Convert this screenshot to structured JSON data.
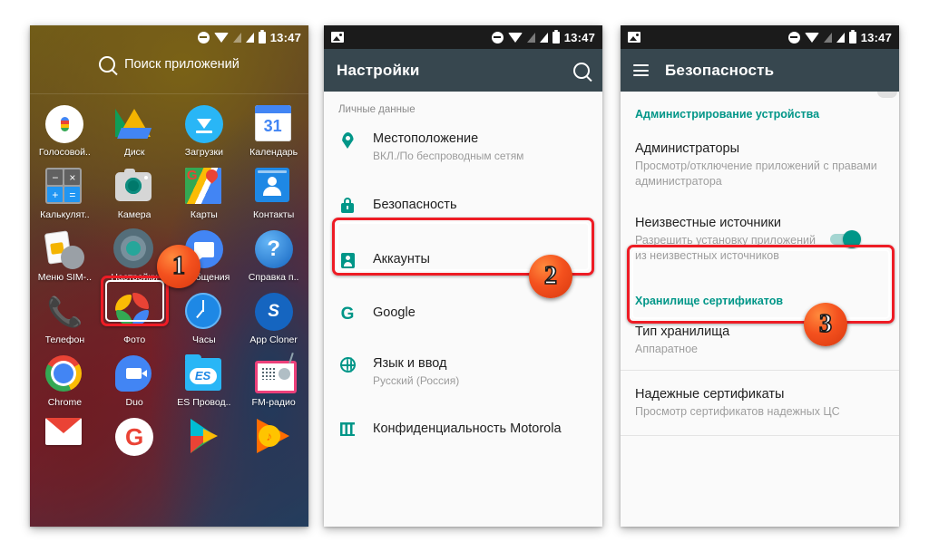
{
  "statusbar": {
    "time": "13:47",
    "icons": [
      "photo-icon",
      "dnd-icon",
      "wifi-icon",
      "signal-empty-icon",
      "signal-icon",
      "battery-icon"
    ]
  },
  "phone1": {
    "search_placeholder": "Поиск приложений",
    "apps": [
      {
        "label": "Голосовой..",
        "icon": "voice-search-icon"
      },
      {
        "label": "Диск",
        "icon": "google-drive-icon"
      },
      {
        "label": "Загрузки",
        "icon": "downloads-icon"
      },
      {
        "label": "Календарь",
        "icon": "calendar-icon",
        "value": "31"
      },
      {
        "label": "Калькулят..",
        "icon": "calculator-icon"
      },
      {
        "label": "Камера",
        "icon": "camera-icon"
      },
      {
        "label": "Карты",
        "icon": "google-maps-icon"
      },
      {
        "label": "Контакты",
        "icon": "contacts-icon"
      },
      {
        "label": "Меню SIM-..",
        "icon": "sim-menu-icon"
      },
      {
        "label": "Настройки",
        "icon": "settings-gear-icon"
      },
      {
        "label": "Сообщения",
        "icon": "messages-icon"
      },
      {
        "label": "Справка п..",
        "icon": "help-icon"
      },
      {
        "label": "Телефон",
        "icon": "phone-icon"
      },
      {
        "label": "Фото",
        "icon": "google-photos-icon"
      },
      {
        "label": "Часы",
        "icon": "clock-icon"
      },
      {
        "label": "App Cloner",
        "icon": "app-cloner-icon"
      },
      {
        "label": "Chrome",
        "icon": "chrome-icon"
      },
      {
        "label": "Duo",
        "icon": "google-duo-icon"
      },
      {
        "label": "ES Провод..",
        "icon": "es-file-explorer-icon"
      },
      {
        "label": "FM-радио",
        "icon": "fm-radio-icon"
      },
      {
        "label": "",
        "icon": "gmail-icon"
      },
      {
        "label": "",
        "icon": "google-icon"
      },
      {
        "label": "",
        "icon": "play-store-icon"
      },
      {
        "label": "",
        "icon": "play-music-icon"
      }
    ]
  },
  "phone2": {
    "title": "Настройки",
    "search_icon": "search-icon",
    "section_label": "Личные данные",
    "rows": [
      {
        "icon": "location-pin-icon",
        "title": "Местоположение",
        "subtitle": "ВКЛ./По беспроводным сетям"
      },
      {
        "icon": "lock-icon",
        "title": "Безопасность",
        "subtitle": ""
      },
      {
        "icon": "account-icon",
        "title": "Аккаунты",
        "subtitle": ""
      },
      {
        "icon": "google-g-icon",
        "title": "Google",
        "subtitle": ""
      },
      {
        "icon": "globe-icon",
        "title": "Язык и ввод",
        "subtitle": "Русский (Россия)"
      },
      {
        "icon": "grid-icon",
        "title": "Конфиденциальность Motorola",
        "subtitle": ""
      }
    ]
  },
  "phone3": {
    "menu_icon": "hamburger-menu-icon",
    "title": "Безопасность",
    "category_1": "Администрирование устройства",
    "category_2": "Хранилище сертификатов",
    "rows": [
      {
        "title": "Администраторы",
        "subtitle": "Просмотр/отключение приложений с правами администратора",
        "toggle": null
      },
      {
        "title": "Неизвестные источники",
        "subtitle": "Разрешить установку приложений из неизвестных источников",
        "toggle": "on"
      },
      {
        "title": "Тип хранилища",
        "subtitle": "Аппаратное",
        "toggle": null
      },
      {
        "title": "Надежные сертификаты",
        "subtitle": "Просмотр сертификатов надежных ЦС",
        "toggle": null
      }
    ]
  },
  "steps": [
    {
      "number": "1",
      "target": "settings-app-icon"
    },
    {
      "number": "2",
      "target": "security-settings-row"
    },
    {
      "number": "3",
      "target": "unknown-sources-row"
    }
  ],
  "colors": {
    "accent_teal": "#009688",
    "appbar": "#37474f",
    "highlight_red": "#ee1c25",
    "badge_orange": "#f4511e"
  }
}
